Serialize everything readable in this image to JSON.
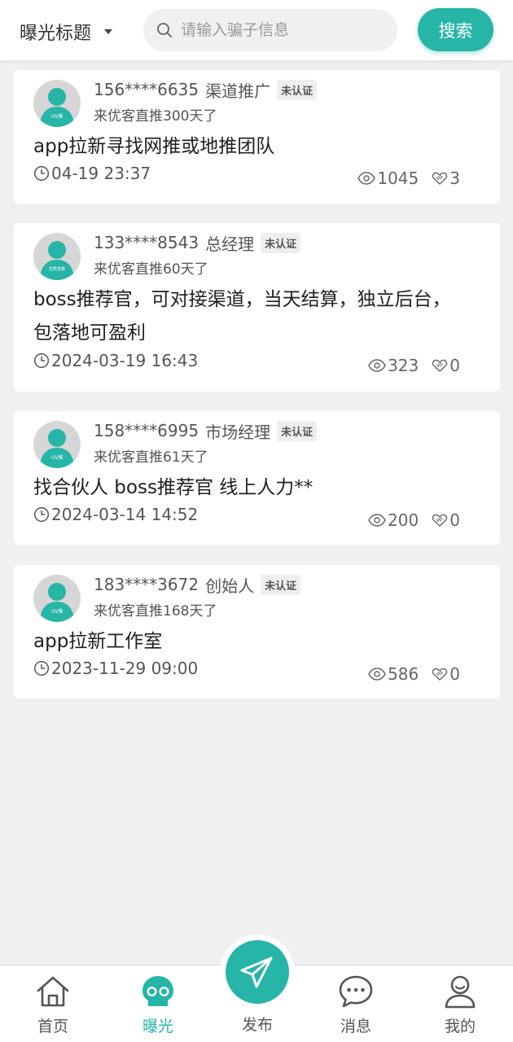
{
  "header": {
    "filter_label": "曝光标题",
    "search_placeholder": "请输入骗子信息",
    "search_button": "搜索"
  },
  "colors": {
    "accent": "#26b5a6",
    "background": "#f0f0f0"
  },
  "posts": [
    {
      "phone": "156****6635",
      "role": "渠道推广",
      "badge": "未认证",
      "since": "来优客直推300天了",
      "avatar_tag": "UV推",
      "content": "app拉新寻找网推或地推团队",
      "time": "04-19 23:37",
      "views": "1045",
      "likes": "3"
    },
    {
      "phone": "133****8543",
      "role": "总经理",
      "badge": "未认证",
      "since": "来优客直推60天了",
      "avatar_tag": "优质直推",
      "content": "boss推荐官，可对接渠道，当天结算，独立后台，包落地可盈利",
      "time": "2024-03-19 16:43",
      "views": "323",
      "likes": "0"
    },
    {
      "phone": "158****6995",
      "role": "市场经理",
      "badge": "未认证",
      "since": "来优客直推61天了",
      "avatar_tag": "UV推",
      "content": "找合伙人 boss推荐官 线上人力**",
      "time": "2024-03-14 14:52",
      "views": "200",
      "likes": "0"
    },
    {
      "phone": "183****3672",
      "role": "创始人",
      "badge": "未认证",
      "since": "来优客直推168天了",
      "avatar_tag": "UV推",
      "content": "app拉新工作室",
      "time": "2023-11-29 09:00",
      "views": "586",
      "likes": "0"
    }
  ],
  "bottom_nav": {
    "items": [
      {
        "label": "首页",
        "icon": "home-icon"
      },
      {
        "label": "曝光",
        "icon": "skull-icon",
        "active": true
      },
      {
        "label": "发布",
        "icon": "paper-plane-icon"
      },
      {
        "label": "消息",
        "icon": "chat-icon"
      },
      {
        "label": "我的",
        "icon": "person-icon"
      }
    ]
  }
}
